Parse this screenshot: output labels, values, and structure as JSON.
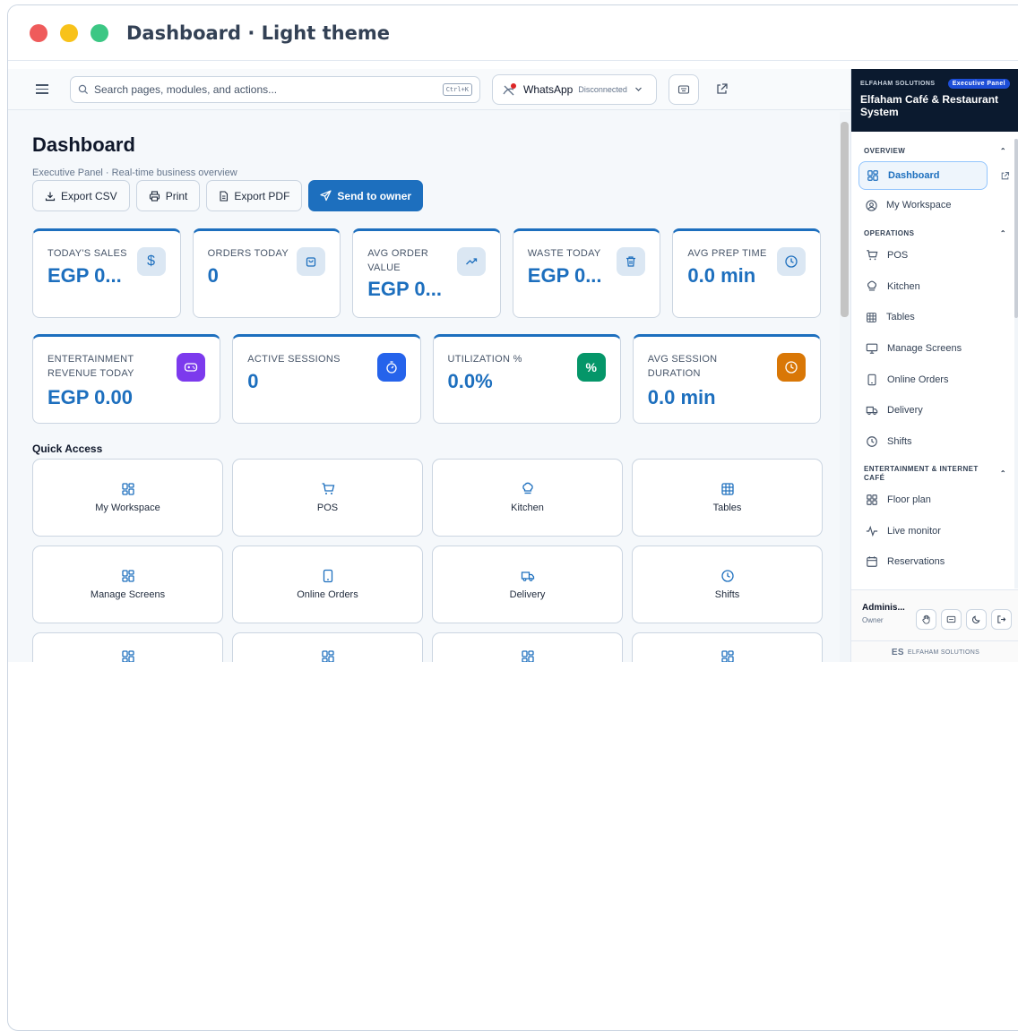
{
  "window": {
    "title": "Dashboard · Light theme"
  },
  "topbar": {
    "search_placeholder": "Search pages, modules, and actions...",
    "search_shortcut": "Ctrl+K",
    "whatsapp_label": "WhatsApp",
    "whatsapp_status": "Disconnected"
  },
  "page": {
    "title": "Dashboard",
    "subtitle": "Executive Panel · Real-time business overview",
    "actions": {
      "export_csv": "Export CSV",
      "print": "Print",
      "export_pdf": "Export PDF",
      "send_to_owner": "Send to owner"
    }
  },
  "kpis_row1": [
    {
      "label": "TODAY'S SALES",
      "value": "EGP 0...",
      "icon": "dollar-icon"
    },
    {
      "label": "ORDERS TODAY",
      "value": "0",
      "icon": "shopping-bag-icon"
    },
    {
      "label": "AVG ORDER VALUE",
      "value": "EGP 0...",
      "icon": "trending-up-icon"
    },
    {
      "label": "WASTE TODAY",
      "value": "EGP 0...",
      "icon": "trash-icon"
    },
    {
      "label": "AVG PREP TIME",
      "value": "0.0 min",
      "icon": "clock-icon"
    }
  ],
  "kpis_row2": [
    {
      "label": "ENTERTAINMENT REVENUE TODAY",
      "value": "EGP 0.00",
      "icon": "gamepad-icon",
      "color": "#7c3aed"
    },
    {
      "label": "ACTIVE SESSIONS",
      "value": "0",
      "icon": "timer-icon",
      "color": "#2563eb"
    },
    {
      "label": "UTILIZATION %",
      "value": "0.0%",
      "icon": "percent-icon",
      "color": "#059669"
    },
    {
      "label": "AVG SESSION DURATION",
      "value": "0.0 min",
      "icon": "clock-icon",
      "color": "#d97706"
    }
  ],
  "quick_access": {
    "title": "Quick Access",
    "tiles": [
      {
        "label": "My Workspace",
        "icon": "grid-icon"
      },
      {
        "label": "POS",
        "icon": "cart-icon"
      },
      {
        "label": "Kitchen",
        "icon": "chef-hat-icon"
      },
      {
        "label": "Tables",
        "icon": "table-icon"
      },
      {
        "label": "Manage Screens",
        "icon": "grid-icon"
      },
      {
        "label": "Online Orders",
        "icon": "tablet-icon"
      },
      {
        "label": "Delivery",
        "icon": "truck-icon"
      },
      {
        "label": "Shifts",
        "icon": "clock-icon"
      }
    ]
  },
  "sidebar": {
    "company": "ELFAHAM SOLUTIONS",
    "panel_badge": "Executive Panel",
    "app_name": "Elfaham Café & Restaurant System",
    "sections": {
      "overview": "OVERVIEW",
      "operations": "OPERATIONS",
      "entertainment": "ENTERTAINMENT & INTERNET CAFÉ"
    },
    "items": {
      "dashboard": "Dashboard",
      "my_workspace": "My Workspace",
      "pos": "POS",
      "kitchen": "Kitchen",
      "tables": "Tables",
      "manage_screens": "Manage Screens",
      "online_orders": "Online Orders",
      "delivery": "Delivery",
      "shifts": "Shifts",
      "floor_plan": "Floor plan",
      "live_monitor": "Live monitor",
      "reservations": "Reservations"
    },
    "user_name": "Adminis...",
    "user_role": "Owner",
    "footer_brand": "ELFAHAM SOLUTIONS"
  },
  "colors": {
    "accent": "#1d6fbe",
    "sidebar_header": "#0b1a2f",
    "dot_red": "#ef5b5b",
    "dot_yellow": "#f8c21a",
    "dot_green": "#3cc784"
  }
}
